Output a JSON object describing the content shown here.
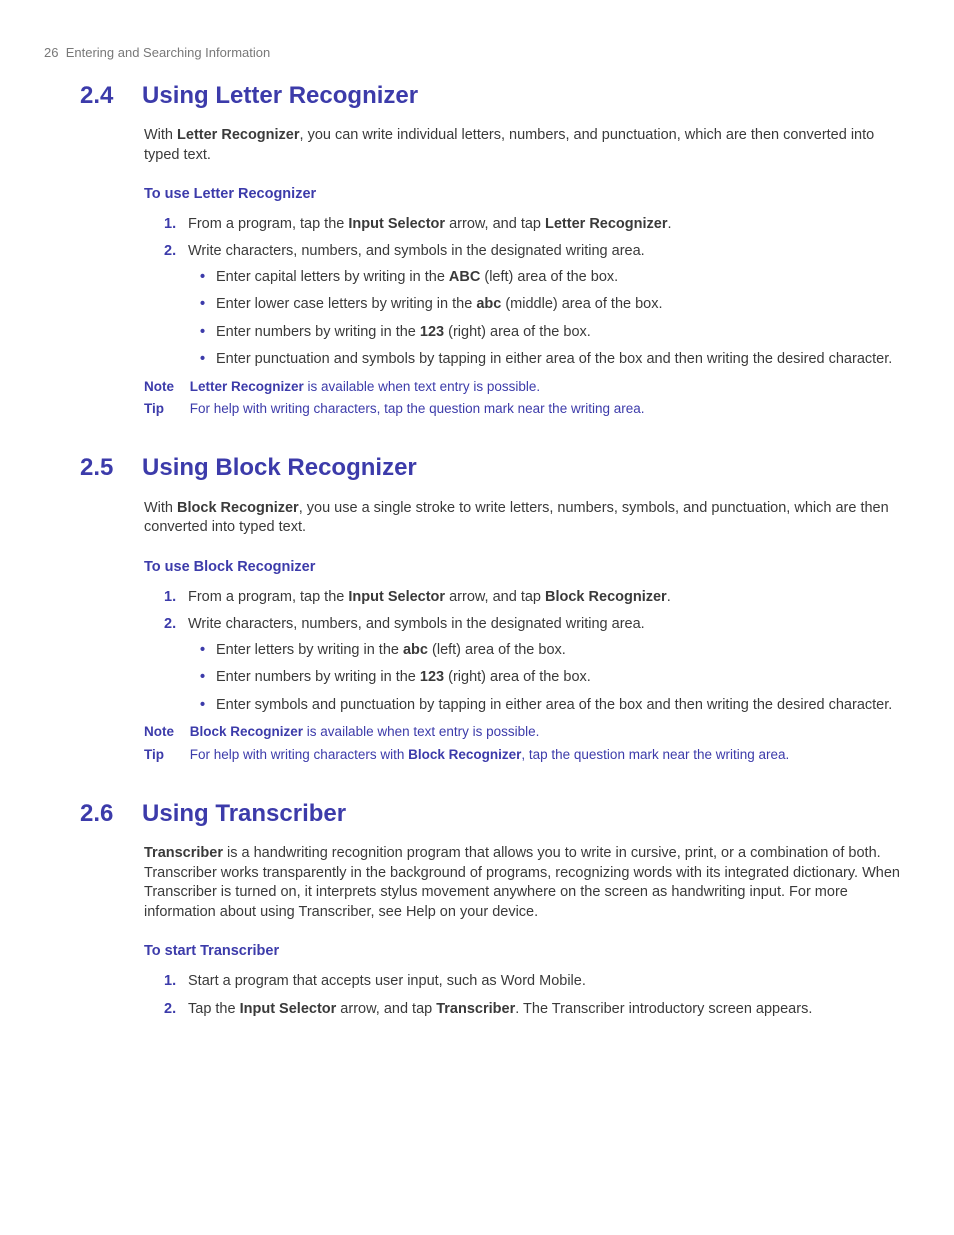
{
  "header": {
    "page_number": "26",
    "chapter_title": "Entering and Searching Information"
  },
  "sec24": {
    "num": "2.4",
    "title": "Using Letter Recognizer",
    "intro_a": "With ",
    "intro_b": "Letter Recognizer",
    "intro_c": ", you can write individual letters, numbers, and punctuation, which are then converted into typed text.",
    "subhead": "To use Letter Recognizer",
    "step1_a": "From a program, tap the ",
    "step1_b": "Input Selector",
    "step1_c": " arrow, and tap ",
    "step1_d": "Letter Recognizer",
    "step1_e": ".",
    "step2": "Write characters, numbers, and symbols in the designated writing area.",
    "bul1_a": "Enter capital letters by writing in the ",
    "bul1_b": "ABC",
    "bul1_c": " (left) area of the box.",
    "bul2_a": "Enter lower case letters by writing in the ",
    "bul2_b": "abc",
    "bul2_c": " (middle) area of the box.",
    "bul3_a": "Enter numbers by writing in the ",
    "bul3_b": "123",
    "bul3_c": " (right) area of the box.",
    "bul4": "Enter punctuation and symbols by tapping in either area of the box and then writing the desired character.",
    "note_label": "Note",
    "note_a": "Letter Recognizer",
    "note_b": " is available when text entry is possible.",
    "tip_label": "Tip",
    "tip": "For help with writing characters, tap the question mark near the writing area."
  },
  "sec25": {
    "num": "2.5",
    "title": "Using Block Recognizer",
    "intro_a": "With ",
    "intro_b": "Block Recognizer",
    "intro_c": ", you use a single stroke to write letters, numbers, symbols, and punctuation, which are then converted into typed text.",
    "subhead": "To use Block Recognizer",
    "step1_a": "From a program, tap the ",
    "step1_b": "Input Selector",
    "step1_c": " arrow, and tap ",
    "step1_d": "Block Recognizer",
    "step1_e": ".",
    "step2": "Write characters, numbers, and symbols in the designated writing area.",
    "bul1_a": "Enter letters by writing in the ",
    "bul1_b": "abc",
    "bul1_c": " (left) area of the box.",
    "bul2_a": "Enter numbers by writing in the ",
    "bul2_b": "123",
    "bul2_c": " (right) area of the box.",
    "bul3": "Enter symbols and punctuation by tapping in either area of the box and then writing the desired character.",
    "note_label": "Note",
    "note_a": "Block Recognizer",
    "note_b": " is available when text entry is possible.",
    "tip_label": "Tip",
    "tip_a": "For help with writing characters with ",
    "tip_b": "Block Recognizer",
    "tip_c": ", tap the question mark near the writing area."
  },
  "sec26": {
    "num": "2.6",
    "title": "Using Transcriber",
    "intro_a": "Transcriber",
    "intro_b": " is a handwriting recognition program that allows you to write in cursive, print, or a combination of both. Transcriber works transparently in the background of programs, recognizing words with its integrated dictionary. When Transcriber is turned on, it interprets stylus movement anywhere on the screen as handwriting input. For more information about using Transcriber, see Help on your device.",
    "subhead": "To start Transcriber",
    "step1": "Start a program that accepts user input, such as Word Mobile.",
    "step2_a": "Tap the ",
    "step2_b": "Input Selector",
    "step2_c": " arrow, and tap ",
    "step2_d": "Transcriber",
    "step2_e": ". The Transcriber introductory screen appears."
  }
}
